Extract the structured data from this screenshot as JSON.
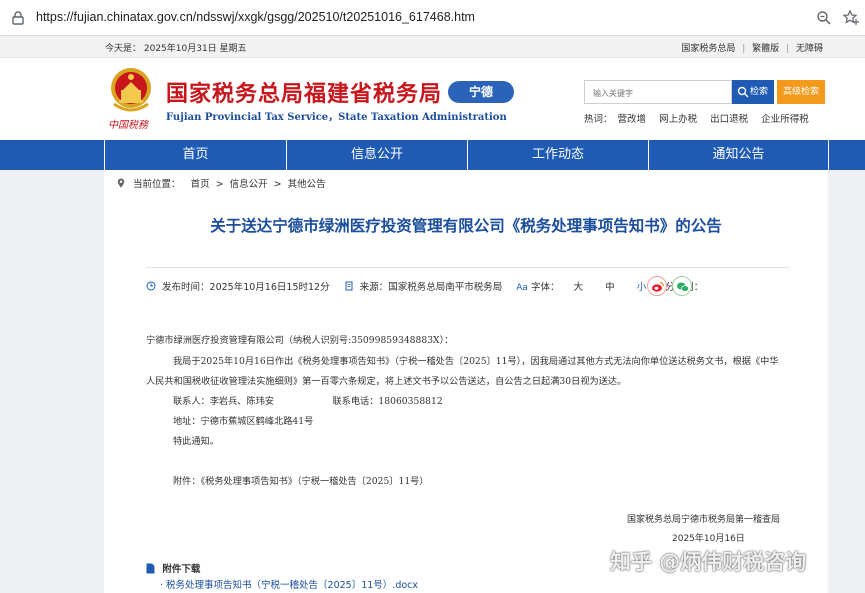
{
  "browser": {
    "url": "https://fujian.chinatax.gov.cn/ndsswj/xxgk/gsgg/202510/t20251016_617468.htm"
  },
  "topstrip": {
    "date": "今天是：  2025年10月31日  星期五",
    "links": [
      "国家税务总局",
      "繁體版",
      "无障碍"
    ]
  },
  "header": {
    "emblem_script": "中国税務",
    "title": "国家税务总局福建省税务局",
    "subtitle": "Fujian Provincial Tax Service，State Taxation Administration",
    "city_badge": "宁德",
    "search_placeholder": "输入关键字",
    "search_button": "检索",
    "advanced_search": "高级检索",
    "hot_label": "热词：",
    "hot_words": [
      "营改增",
      "网上办税",
      "出口退税",
      "企业所得税"
    ]
  },
  "nav": [
    "首页",
    "信息公开",
    "工作动态",
    "通知公告"
  ],
  "breadcrumb": {
    "label": "当前位置：",
    "items": [
      "首页",
      ">",
      "信息公开",
      ">",
      "其他公告"
    ]
  },
  "article": {
    "title": "关于送达宁德市绿洲医疗投资管理有限公司《税务处理事项告知书》的公告",
    "publish_label": "发布时间：",
    "publish_time": "2025年10月16日15时12分",
    "source_label": "来源：",
    "source": "国家税务总局南平市税务局",
    "font_label": "字体：",
    "font_sizes": [
      "大",
      "中",
      "小"
    ],
    "share_label": "分享到：",
    "lines": [
      "宁德市绿洲医疗投资管理有限公司（纳税人识别号:35099859348883X）：",
      "我局于2025年10月16日作出《税务处理事项告知书》（宁税一稽处告〔2025〕11号），因我局通过其他方式无法向你单位送达税务文书，根据《中华",
      "人民共和国税收征收管理法实施细则》第一百零六条规定，将上述文书予以公告送达，自公告之日起满30日视为送达。",
      "联系人：李岩兵、陈玮安                    联系电话：18060358812",
      "地址：宁德市蕉城区鹤峰北路41号",
      "特此通知。",
      "附件：《税务处理事项告知书》（宁税一稽处告〔2025〕11号）"
    ],
    "sign_org": "国家税务总局宁德市税务局第一稽查局",
    "sign_date": "2025年10月16日"
  },
  "attachments": {
    "heading": "附件下载",
    "items": [
      "· 税务处理事项告知书（宁税一稽处告〔2025〕11号）.docx"
    ]
  },
  "watermark": "知乎 @炳伟财税咨询",
  "colors": {
    "brand_red": "#c8161d",
    "nav_blue": "#1f5bb5",
    "title_blue": "#1a4d9c",
    "advanced_orange": "#f39a1d"
  }
}
